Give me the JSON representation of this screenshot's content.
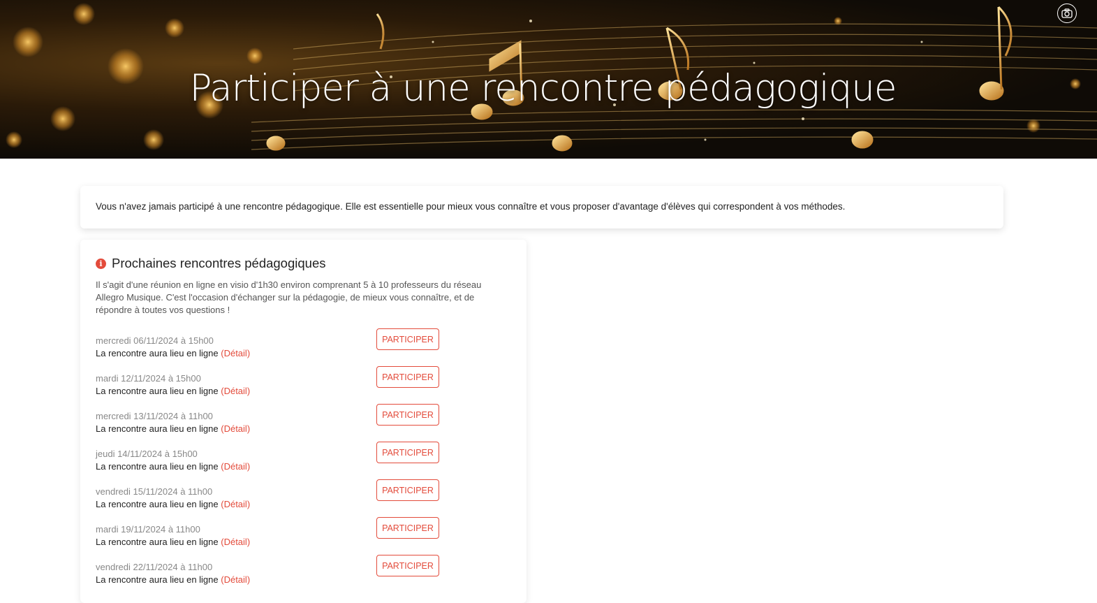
{
  "hero": {
    "title": "Participer à une rencontre pédagogique",
    "camera_icon": "camera-icon"
  },
  "notice": {
    "text": "Vous n'avez jamais participé à une rencontre pédagogique. Elle est essentielle pour mieux vous connaître et vous proposer d'avantage d'élèves qui correspondent à vos méthodes."
  },
  "meetings": {
    "title": "Prochaines rencontres pédagogiques",
    "info_icon": "info-icon",
    "description": "Il s'agit d'une réunion en ligne en visio d'1h30 environ comprenant 5 à 10 professeurs du réseau Allegro Musique. C'est l'occasion d'échanger sur la pédagogie, de mieux vous connaître, et de répondre à toutes vos questions !",
    "items": [
      {
        "date": "mercredi 06/11/2024 à 15h00",
        "place": "La rencontre aura lieu en ligne",
        "detail": "(Détail)",
        "button": "PARTICIPER"
      },
      {
        "date": "mardi 12/11/2024 à 15h00",
        "place": "La rencontre aura lieu en ligne",
        "detail": "(Détail)",
        "button": "PARTICIPER"
      },
      {
        "date": "mercredi 13/11/2024 à 11h00",
        "place": "La rencontre aura lieu en ligne",
        "detail": "(Détail)",
        "button": "PARTICIPER"
      },
      {
        "date": "jeudi 14/11/2024 à 15h00",
        "place": "La rencontre aura lieu en ligne",
        "detail": "(Détail)",
        "button": "PARTICIPER"
      },
      {
        "date": "vendredi 15/11/2024 à 11h00",
        "place": "La rencontre aura lieu en ligne",
        "detail": "(Détail)",
        "button": "PARTICIPER"
      },
      {
        "date": "mardi 19/11/2024 à 11h00",
        "place": "La rencontre aura lieu en ligne",
        "detail": "(Détail)",
        "button": "PARTICIPER"
      },
      {
        "date": "vendredi 22/11/2024 à 11h00",
        "place": "La rencontre aura lieu en ligne",
        "detail": "(Détail)",
        "button": "PARTICIPER"
      }
    ]
  },
  "colors": {
    "accent": "#e34b3b",
    "hero_dark": "#0f0b06",
    "hero_gold": "#d9a441"
  }
}
